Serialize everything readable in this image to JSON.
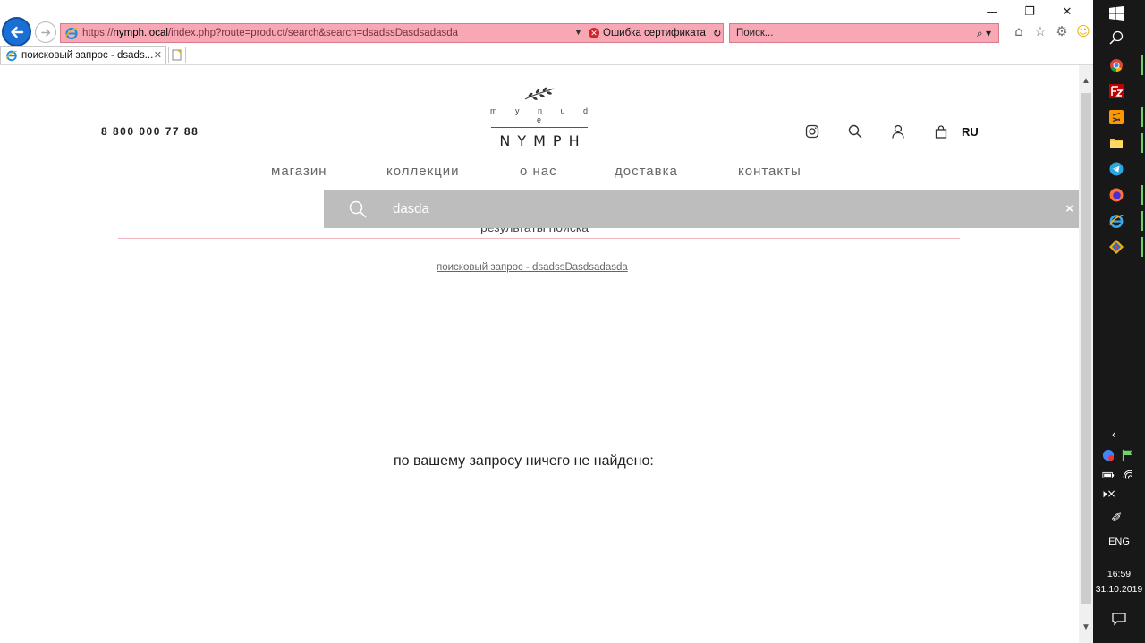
{
  "browser": {
    "url_protocol": "https://",
    "url_host": "nymph.local",
    "url_rest": "/index.php?route=product/search&search=dsadssDasdsadasda",
    "cert_error": "Ошибка сертификата",
    "search_placeholder": "Поиск...",
    "tab_title": "поисковый запрос - dsads...",
    "window_controls": [
      "—",
      "❐",
      "✕"
    ]
  },
  "header": {
    "phone": "8 800 000 77 88",
    "logo_small": "m y n u d e",
    "logo_big": "NYMPH",
    "lang": "RU"
  },
  "menu": {
    "items": [
      "магазин",
      "коллекции",
      "о нас",
      "доставка",
      "контакты"
    ]
  },
  "search": {
    "value": "dasda",
    "close": "×"
  },
  "results": {
    "title": "результаты поиска",
    "breadcrumb": "поисковый запрос - dsadssDasdsadasda",
    "empty_message": "по вашему запросу ничего не найдено:"
  },
  "taskbar": {
    "lang": "ENG",
    "time": "16:59",
    "date": "31.10.2019"
  },
  "colors": {
    "address_bar_error": "#f7a8b4",
    "search_overlay": "#bdbdbd",
    "pink_rule": "#f3b6c0",
    "taskbar": "#181818"
  }
}
